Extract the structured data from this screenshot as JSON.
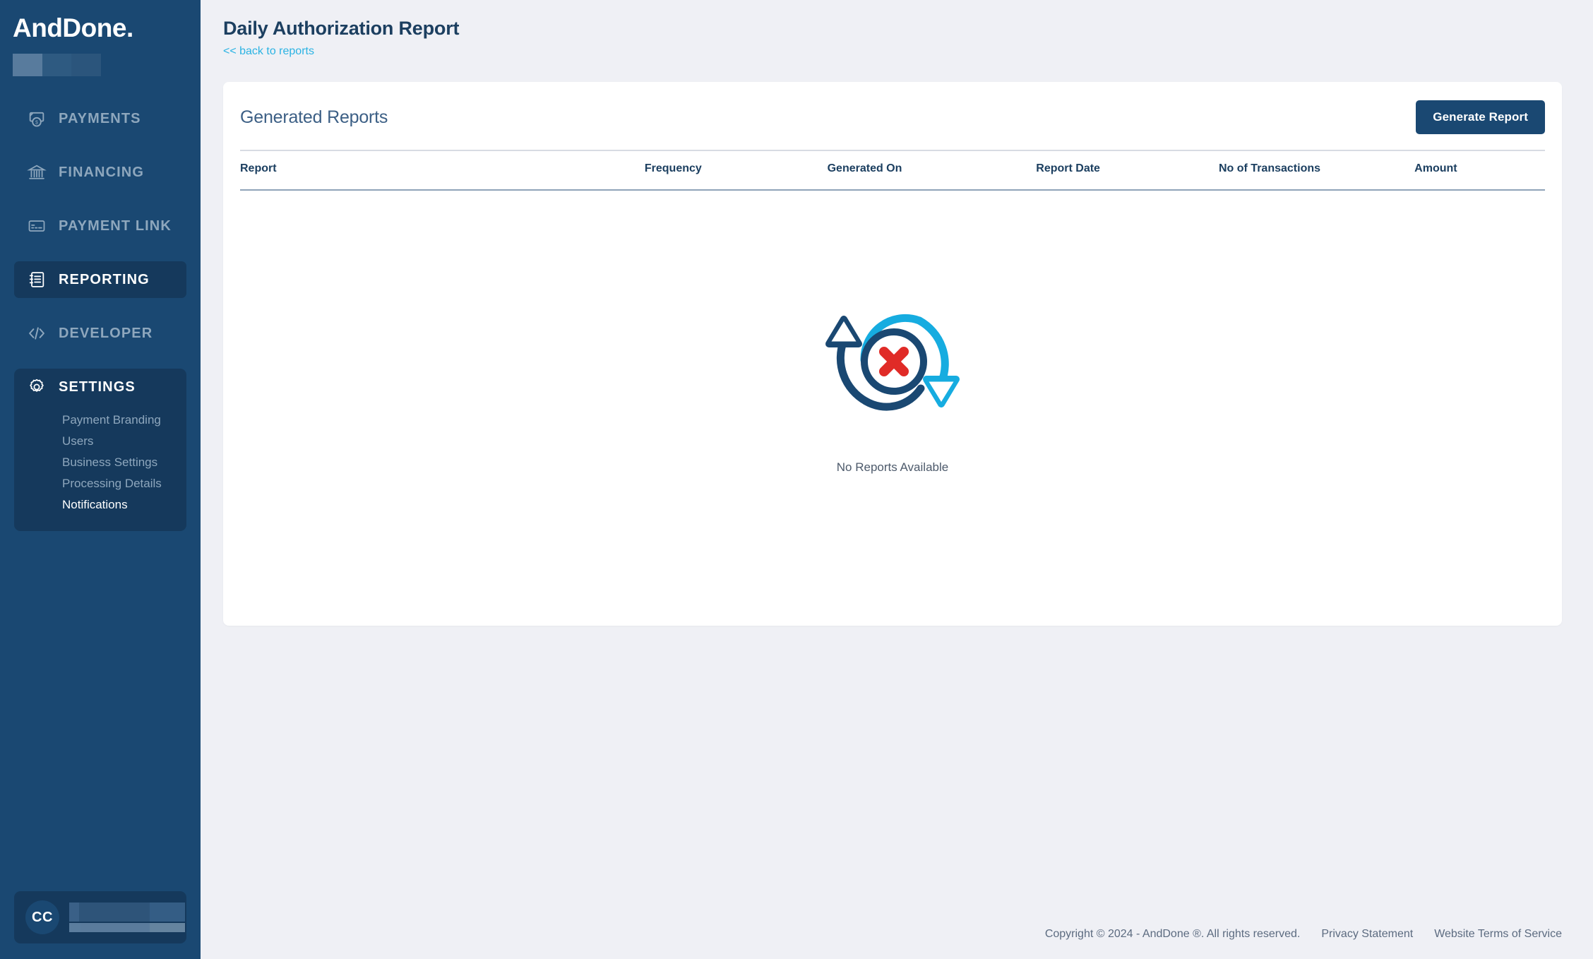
{
  "brand": {
    "logo_text": "AndDone",
    "logo_dot": "."
  },
  "sidebar": {
    "items": [
      {
        "label": "PAYMENTS",
        "icon": "banknote-coin-icon",
        "active": false
      },
      {
        "label": "FINANCING",
        "icon": "bank-icon",
        "active": false
      },
      {
        "label": "PAYMENT LINK",
        "icon": "card-link-icon",
        "active": false
      },
      {
        "label": "REPORTING",
        "icon": "report-document-icon",
        "active": true
      },
      {
        "label": "DEVELOPER",
        "icon": "code-brackets-icon",
        "active": false
      }
    ],
    "settings": {
      "label": "SETTINGS",
      "icon": "gear-icon",
      "sub_items": [
        {
          "label": "Payment Branding",
          "active": false
        },
        {
          "label": "Users",
          "active": false
        },
        {
          "label": "Business Settings",
          "active": false
        },
        {
          "label": "Processing Details",
          "active": false
        },
        {
          "label": "Notifications",
          "active": true
        }
      ]
    },
    "user": {
      "initials": "CC"
    }
  },
  "header": {
    "title": "Daily Authorization Report",
    "back_link": "<< back to reports"
  },
  "card": {
    "title": "Generated Reports",
    "generate_button": "Generate Report",
    "columns": [
      "Report",
      "Frequency",
      "Generated On",
      "Report Date",
      "No of Transactions",
      "Amount"
    ],
    "rows": [],
    "empty_state": {
      "icon": "sync-error-icon",
      "text": "No Reports Available"
    }
  },
  "footer": {
    "copyright": "Copyright © 2024 - AndDone ®. All rights reserved.",
    "privacy": "Privacy Statement",
    "terms": "Website Terms of Service"
  },
  "colors": {
    "sidebar_bg": "#1a4872",
    "sidebar_active": "#15395c",
    "page_bg": "#eff0f5",
    "accent_link": "#2bb3e3",
    "primary": "#1a4872",
    "illustration_dark": "#1a4872",
    "illustration_light": "#16ace0",
    "illustration_error": "#e02b27"
  }
}
